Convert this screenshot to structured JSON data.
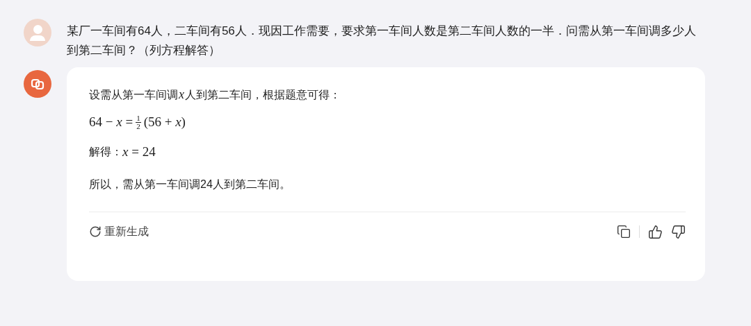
{
  "question": "某厂一车间有64人，二车间有56人．现因工作需要，要求第一车间人数是第二车间人数的一半．问需从第一车间调多少人到第二车间？（列方程解答）",
  "answer": {
    "intro": {
      "before": "设需从第一车间调",
      "variable": "x",
      "after": "人到第二车间，根据题意可得："
    },
    "equation": {
      "left": "64 − *x* =",
      "numerator": "1",
      "denominator": "2",
      "right": "(56 + *x*)"
    },
    "solution": {
      "label": "解得：",
      "math": "*x* = 24"
    },
    "conclusion": "所以，需从第一车间调24人到第二车间。"
  },
  "actions": {
    "regenerate": "重新生成"
  }
}
